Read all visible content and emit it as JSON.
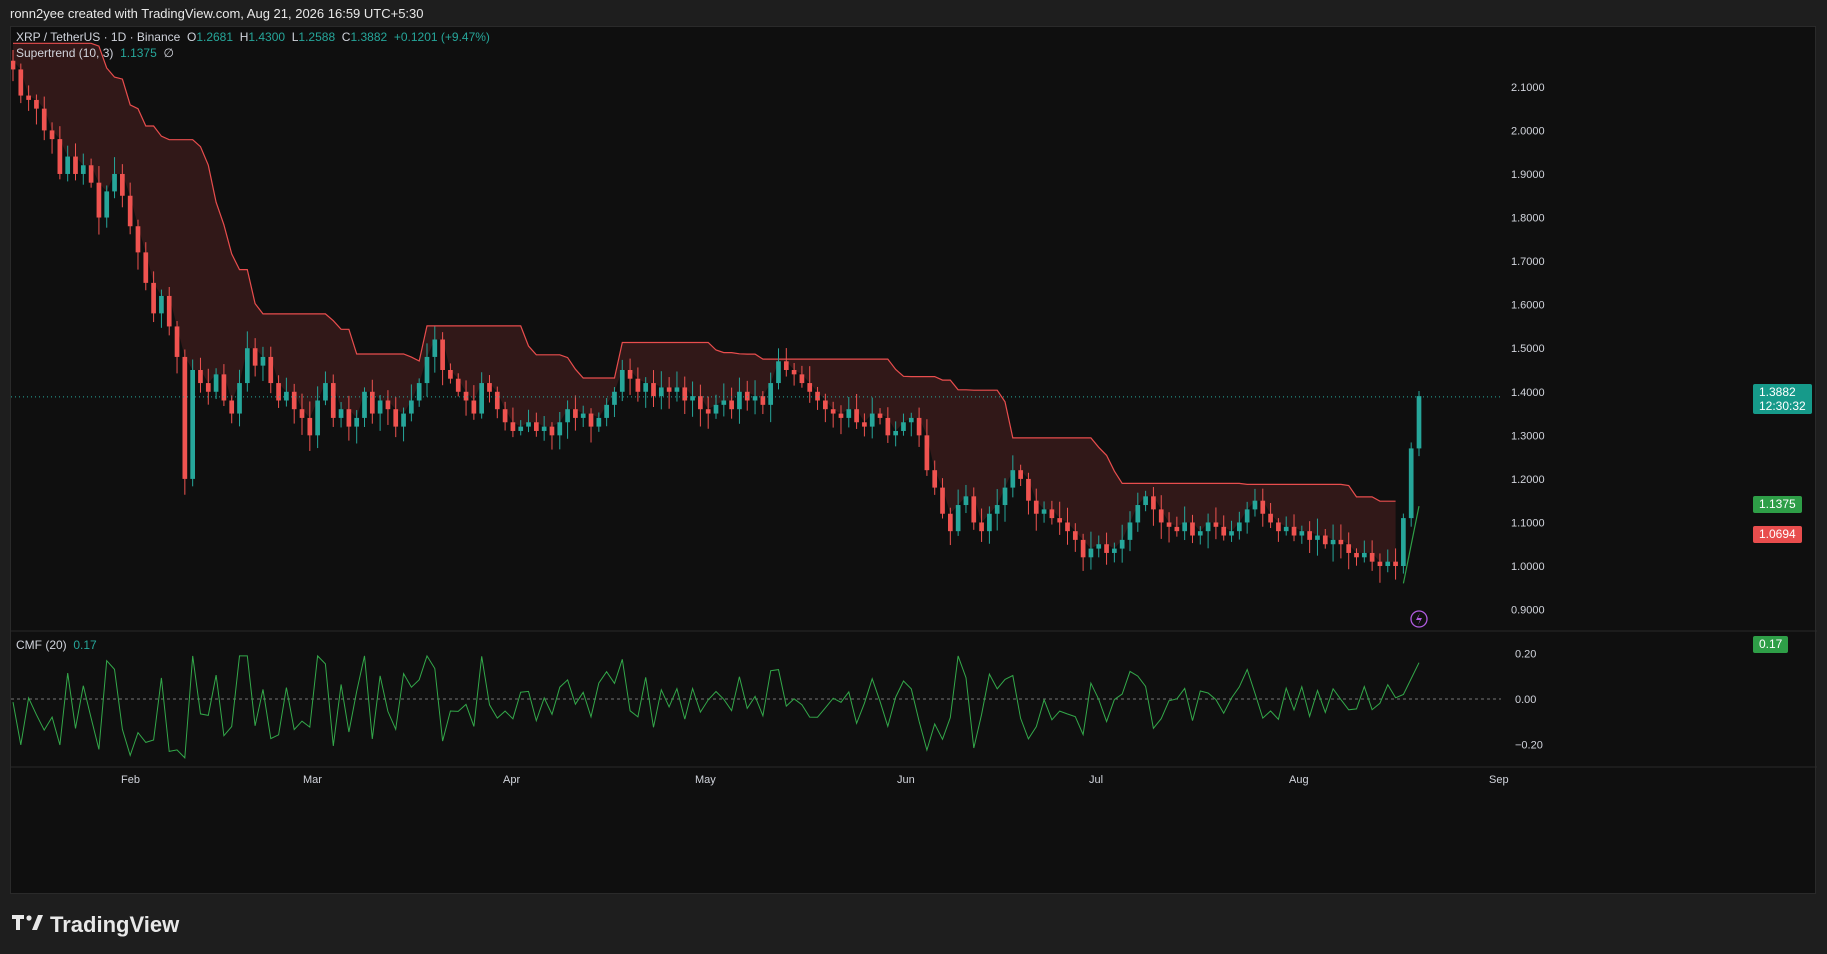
{
  "header": {
    "credit": "ronn2yee created with TradingView.com, Aug 21, 2026 16:59 UTC+5:30"
  },
  "symbol": {
    "name": "XRP / TetherUS · 1D · Binance",
    "o_label": "O",
    "o": "1.2681",
    "h_label": "H",
    "h": "1.4300",
    "l_label": "L",
    "l": "1.2588",
    "c_label": "C",
    "c": "1.3882",
    "change": "+0.1201 (+9.47%)"
  },
  "supertrend": {
    "label": "Supertrend (10, 3)",
    "value": "1.1375",
    "extra": "∅"
  },
  "cmf": {
    "label": "CMF (20)",
    "value": "0.17"
  },
  "price_axis": {
    "ticks": [
      "2.1000",
      "2.0000",
      "1.9000",
      "1.8000",
      "1.7000",
      "1.6000",
      "1.5000",
      "1.4000",
      "1.3000",
      "1.2000",
      "1.1000",
      "1.0000",
      "0.9000"
    ],
    "current_price": "1.3882",
    "countdown": "12:30:32",
    "supertrend_tag": "1.1375",
    "low_tag": "1.0694"
  },
  "cmf_axis": {
    "ticks": [
      "0.20",
      "0.00",
      "−0.20"
    ],
    "current": "0.17"
  },
  "time_axis": {
    "labels": [
      "Feb",
      "Mar",
      "Apr",
      "May",
      "Jun",
      "Jul",
      "Aug",
      "Sep"
    ]
  },
  "colors": {
    "up": "#26a69a",
    "down": "#ef5350",
    "st_up": "#2e9e47",
    "st_down": "#e84d4d",
    "cmf": "#33a84a",
    "bg": "#0f0f0f"
  },
  "brand": {
    "name": "TradingView"
  },
  "chart_data": {
    "type": "candlestick",
    "title": "XRP / TetherUS · 1D · Binance",
    "x_labels": [
      "Feb",
      "Mar",
      "Apr",
      "May",
      "Jun",
      "Jul",
      "Aug",
      "Sep"
    ],
    "ylim": [
      0.86,
      2.18
    ],
    "cmf_ylim": [
      -0.3,
      0.3
    ],
    "close": [
      2.14,
      2.08,
      2.07,
      2.05,
      2.0,
      1.98,
      1.9,
      1.94,
      1.9,
      1.92,
      1.88,
      1.8,
      1.86,
      1.9,
      1.85,
      1.78,
      1.72,
      1.65,
      1.58,
      1.62,
      1.55,
      1.48,
      1.2,
      1.45,
      1.42,
      1.4,
      1.44,
      1.38,
      1.35,
      1.42,
      1.5,
      1.46,
      1.48,
      1.42,
      1.38,
      1.4,
      1.36,
      1.34,
      1.3,
      1.38,
      1.42,
      1.34,
      1.36,
      1.32,
      1.34,
      1.4,
      1.35,
      1.38,
      1.36,
      1.32,
      1.35,
      1.38,
      1.42,
      1.48,
      1.52,
      1.45,
      1.43,
      1.4,
      1.38,
      1.35,
      1.42,
      1.4,
      1.36,
      1.33,
      1.31,
      1.32,
      1.33,
      1.31,
      1.32,
      1.3,
      1.33,
      1.36,
      1.34,
      1.35,
      1.32,
      1.34,
      1.37,
      1.4,
      1.45,
      1.43,
      1.4,
      1.42,
      1.39,
      1.41,
      1.4,
      1.41,
      1.38,
      1.39,
      1.36,
      1.35,
      1.37,
      1.38,
      1.36,
      1.4,
      1.38,
      1.39,
      1.37,
      1.42,
      1.47,
      1.45,
      1.44,
      1.42,
      1.4,
      1.38,
      1.36,
      1.35,
      1.34,
      1.36,
      1.33,
      1.32,
      1.35,
      1.34,
      1.3,
      1.31,
      1.33,
      1.34,
      1.3,
      1.22,
      1.18,
      1.12,
      1.08,
      1.14,
      1.16,
      1.1,
      1.08,
      1.12,
      1.14,
      1.18,
      1.22,
      1.2,
      1.15,
      1.12,
      1.13,
      1.11,
      1.1,
      1.08,
      1.06,
      1.02,
      1.04,
      1.05,
      1.03,
      1.04,
      1.06,
      1.1,
      1.14,
      1.16,
      1.13,
      1.1,
      1.09,
      1.08,
      1.1,
      1.07,
      1.08,
      1.1,
      1.09,
      1.07,
      1.08,
      1.1,
      1.13,
      1.15,
      1.12,
      1.1,
      1.08,
      1.09,
      1.07,
      1.08,
      1.06,
      1.07,
      1.05,
      1.06,
      1.05,
      1.03,
      1.02,
      1.03,
      1.01,
      1.0,
      1.01,
      1.0,
      1.11,
      1.27,
      1.39
    ],
    "supertrend_value": 1.1375
  }
}
